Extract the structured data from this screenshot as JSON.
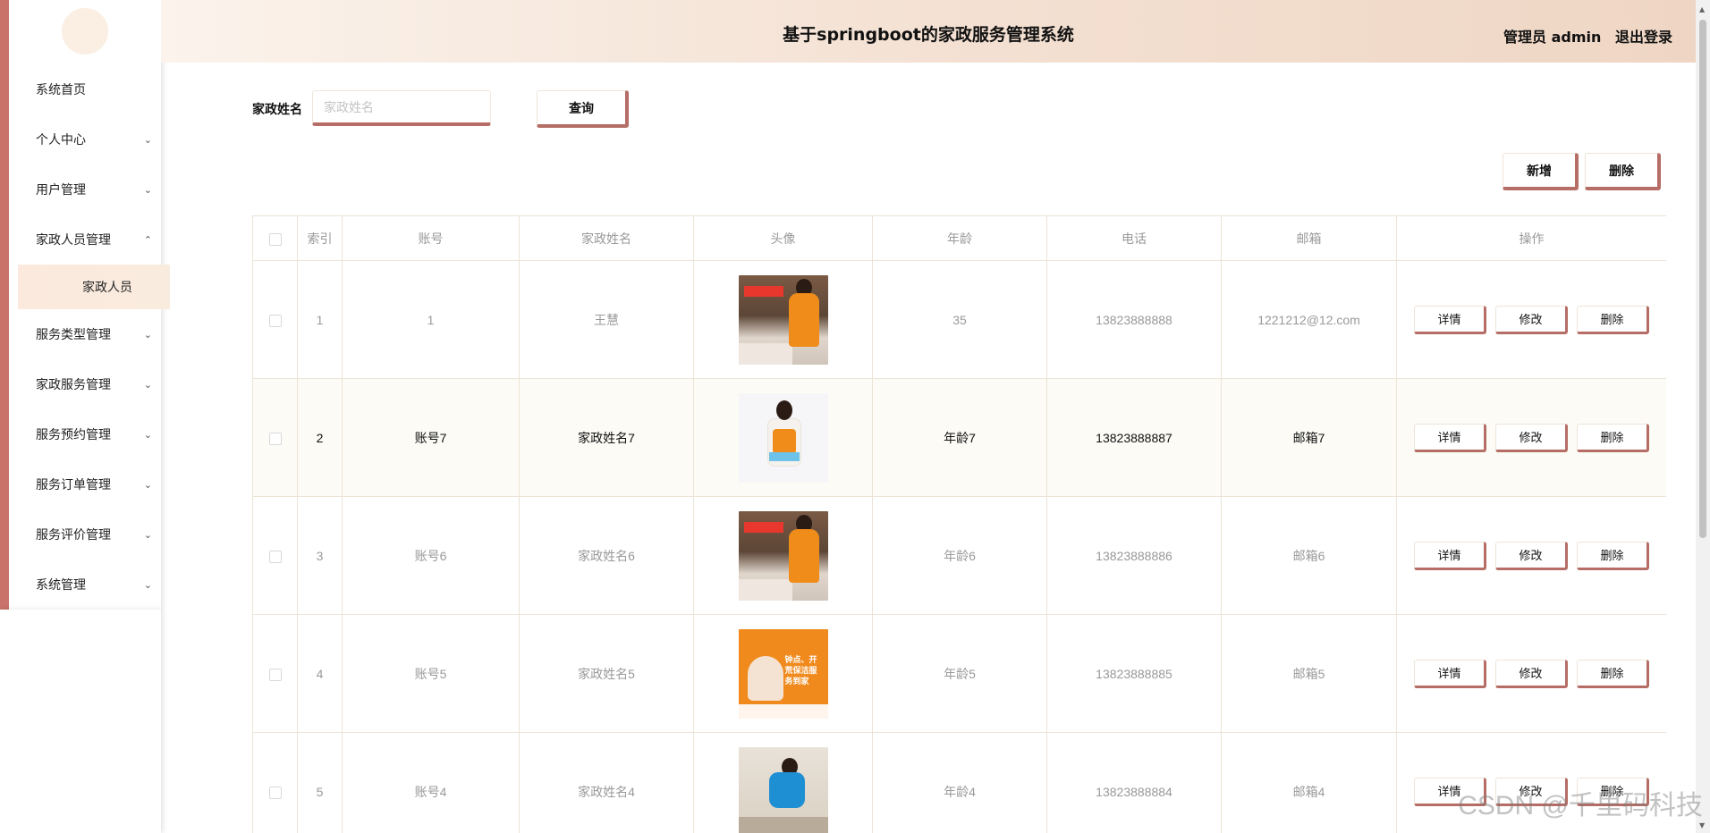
{
  "header": {
    "title": "基于springboot的家政服务管理系统",
    "user_label": "管理员 admin",
    "logout_label": "退出登录"
  },
  "sidebar": {
    "items": [
      {
        "label": "系统首页",
        "expanded": null
      },
      {
        "label": "个人中心",
        "expanded": false
      },
      {
        "label": "用户管理",
        "expanded": false
      },
      {
        "label": "家政人员管理",
        "expanded": true
      },
      {
        "label": "家政人员",
        "sub": true
      },
      {
        "label": "服务类型管理",
        "expanded": false
      },
      {
        "label": "家政服务管理",
        "expanded": false
      },
      {
        "label": "服务预约管理",
        "expanded": false
      },
      {
        "label": "服务订单管理",
        "expanded": false
      },
      {
        "label": "服务评价管理",
        "expanded": false
      },
      {
        "label": "系统管理",
        "expanded": false
      }
    ]
  },
  "search": {
    "label": "家政姓名",
    "placeholder": "家政姓名",
    "query_label": "查询"
  },
  "actions": {
    "add_label": "新增",
    "delete_label": "删除"
  },
  "table": {
    "headers": [
      "",
      "索引",
      "账号",
      "家政姓名",
      "头像",
      "年龄",
      "电话",
      "邮箱",
      "操作"
    ],
    "rows": [
      {
        "index": "1",
        "account": "1",
        "name": "王慧",
        "photo": "photo-orange-kitchen",
        "age": "35",
        "phone": "13823888888",
        "email": "1221212@12.com"
      },
      {
        "index": "2",
        "account": "账号7",
        "name": "家政姓名7",
        "photo": "photo-white",
        "age": "年龄7",
        "phone": "13823888887",
        "email": "邮箱7"
      },
      {
        "index": "3",
        "account": "账号6",
        "name": "家政姓名6",
        "photo": "photo-orange-kitchen",
        "age": "年龄6",
        "phone": "13823888886",
        "email": "邮箱6"
      },
      {
        "index": "4",
        "account": "账号5",
        "name": "家政姓名5",
        "photo": "photo-orange-ad",
        "age": "年龄5",
        "phone": "13823888885",
        "email": "邮箱5"
      },
      {
        "index": "5",
        "account": "账号4",
        "name": "家政姓名4",
        "photo": "photo-blue",
        "age": "年龄4",
        "phone": "13823888884",
        "email": "邮箱4"
      }
    ],
    "row_actions": {
      "detail": "详情",
      "edit": "修改",
      "delete": "删除"
    }
  },
  "photo_texts": {
    "kitchen_tag": "家政服务员",
    "ad_text": "钟点、开荒保洁服务到家"
  },
  "watermark": "CSDN @千里码科技",
  "colors": {
    "accent": "#b56d65",
    "sidebar_border": "#c8726a",
    "highlight_row": "#fcfbf6"
  }
}
